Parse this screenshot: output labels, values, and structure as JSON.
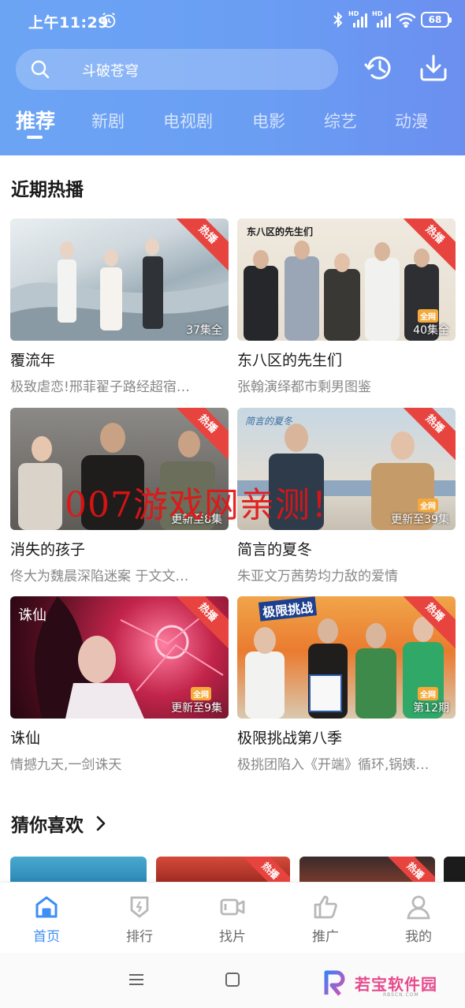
{
  "status_bar": {
    "time": "上午11:29",
    "battery": "68",
    "signal_label": "HD"
  },
  "search": {
    "placeholder": "斗破苍穹"
  },
  "tabs": [
    {
      "label": "推荐",
      "active": true
    },
    {
      "label": "新剧"
    },
    {
      "label": "电视剧"
    },
    {
      "label": "电影"
    },
    {
      "label": "综艺"
    },
    {
      "label": "动漫"
    }
  ],
  "recent": {
    "title": "近期热播",
    "items": [
      {
        "title": "覆流年",
        "desc": "极致虐恋!邢菲翟子路经超宿…",
        "episodes": "37集全",
        "badge": "热播",
        "quanwang": ""
      },
      {
        "title": "东八区的先生们",
        "desc": "张翰演绎都市剩男图鉴",
        "episodes": "40集全",
        "badge": "热播",
        "quanwang": "全网",
        "poster_text": "东八区的先生们"
      },
      {
        "title": "消失的孩子",
        "desc": "佟大为魏晨深陷迷案 于文文…",
        "episodes": "更新至8集",
        "badge": "热播",
        "quanwang": ""
      },
      {
        "title": "简言的夏冬",
        "desc": "朱亚文万茜势均力敌的爱情",
        "episodes": "更新至39集",
        "badge": "热播",
        "quanwang": "全网",
        "poster_text": "简言的夏冬"
      },
      {
        "title": "诛仙",
        "desc": "情撼九天,一剑诛天",
        "episodes": "更新至9集",
        "badge": "热播",
        "quanwang": "全网",
        "poster_text": "诛仙"
      },
      {
        "title": "极限挑战第八季",
        "desc": "极挑团陷入《开端》循环,锅姨…",
        "episodes": "第12期",
        "badge": "热播",
        "quanwang": "全网",
        "poster_text": "极限挑战"
      }
    ]
  },
  "watermark": "007游戏网亲测！",
  "guess": {
    "title": "猜你喜欢",
    "badge": "热播"
  },
  "bottom_nav": [
    {
      "label": "首页",
      "active": true
    },
    {
      "label": "排行"
    },
    {
      "label": "找片"
    },
    {
      "label": "推广"
    },
    {
      "label": "我的"
    }
  ],
  "system_bar": {
    "brand_name": "若宝软件园",
    "brand_sub": "RBSCN.COM"
  },
  "colors": {
    "header_gradient_start": "#6ca4f4",
    "header_gradient_end": "#6b8ff0",
    "hot_badge": "#e8443f",
    "nav_active": "#3d8ef5",
    "quanwang_badge": "#f4a93a"
  }
}
